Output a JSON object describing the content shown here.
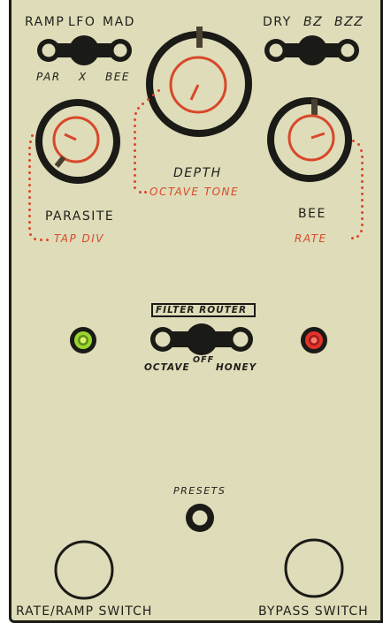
{
  "colors": {
    "panel": "#dfdcb9",
    "ink": "#1a1a16",
    "accent": "#d7482a",
    "led_left": "#9ad630",
    "led_right": "#e5312b"
  },
  "top_left_switch": {
    "labels_top": [
      "RAMP",
      "LFO",
      "MAD"
    ],
    "labels_bottom": [
      "PAR",
      "X",
      "BEE"
    ],
    "selected_index": 1
  },
  "top_right_switch": {
    "labels_top": [
      "DRY",
      "BZ",
      "BZZ"
    ],
    "selected_index": 1
  },
  "knobs": {
    "depth": {
      "label": "DEPTH",
      "secondary_label": "OCTAVE TONE"
    },
    "parasite": {
      "label": "PARASITE",
      "secondary_label": "TAP DIV"
    },
    "bee": {
      "label": "BEE",
      "secondary_label": "RATE"
    }
  },
  "filter_router": {
    "title": "FILTER ROUTER",
    "options": [
      "OCTAVE",
      "OFF",
      "HONEY"
    ],
    "selected_index": 1
  },
  "leds": {
    "left": "led-green-icon",
    "right": "led-red-icon"
  },
  "presets": {
    "label": "PRESETS"
  },
  "footswitches": {
    "left": "RATE/RAMP SWITCH",
    "right": "BYPASS SWITCH"
  }
}
